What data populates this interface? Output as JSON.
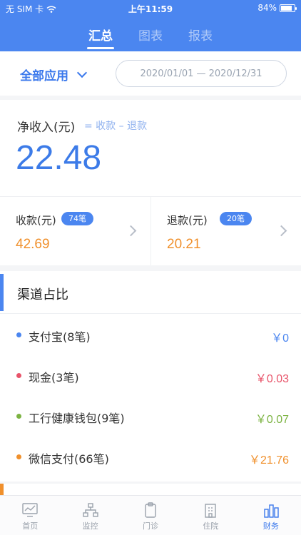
{
  "status_bar": {
    "carrier": "无 SIM 卡",
    "time": "上午11:59",
    "battery": "84%",
    "battery_level": 0.84
  },
  "tabs": [
    {
      "label": "汇总",
      "active": true
    },
    {
      "label": "图表",
      "active": false
    },
    {
      "label": "报表",
      "active": false
    }
  ],
  "filter": {
    "app_label": "全部应用",
    "date_range": "2020/01/01 — 2020/12/31"
  },
  "net": {
    "title": "净收入(元)",
    "formula": "= 收款 – 退款",
    "amount": "22.48"
  },
  "income": {
    "label": "收款(元)",
    "count": "74笔",
    "amount": "42.69"
  },
  "refund": {
    "label": "退款(元)",
    "count": "20笔",
    "amount": "20.21"
  },
  "channel": {
    "title": "渠道占比",
    "items": [
      {
        "name": "支付宝(8笔)",
        "amount": "￥0",
        "color": "#4b86f0"
      },
      {
        "name": "现金(3笔)",
        "amount": "￥0.03",
        "color": "#e8546a"
      },
      {
        "name": "工行健康钱包(9笔)",
        "amount": "￥0.07",
        "color": "#7cb342"
      },
      {
        "name": "微信支付(66笔)",
        "amount": "￥21.76",
        "color": "#f0902c"
      }
    ]
  },
  "tabbar": [
    {
      "label": "首页",
      "icon": "monitor-chart-icon",
      "active": false
    },
    {
      "label": "监控",
      "icon": "network-icon",
      "active": false
    },
    {
      "label": "门诊",
      "icon": "clipboard-icon",
      "active": false
    },
    {
      "label": "住院",
      "icon": "building-icon",
      "active": false
    },
    {
      "label": "财务",
      "icon": "bar-chart-icon",
      "active": true
    }
  ],
  "colors": {
    "brand": "#4b86f0",
    "accent_orange": "#f0902c",
    "amount_blue": "#3c7be8"
  }
}
